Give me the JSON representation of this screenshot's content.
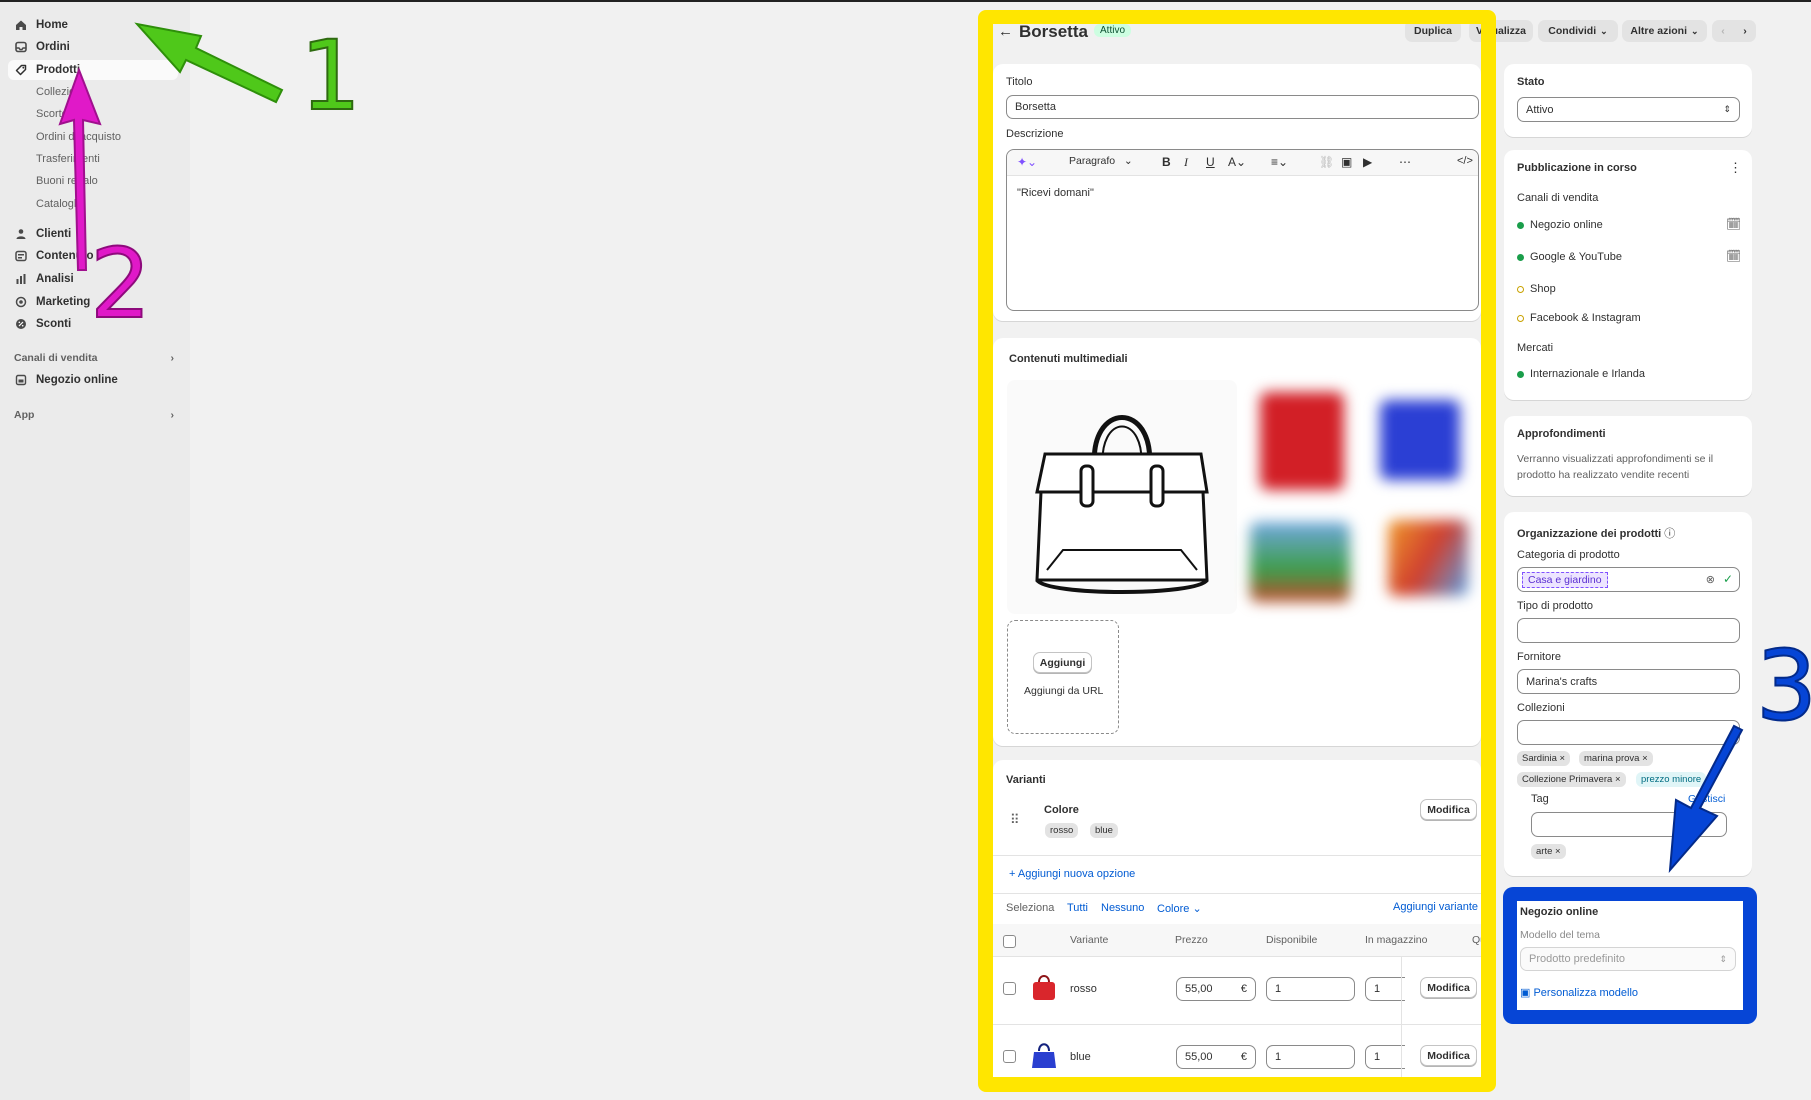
{
  "sidebar": {
    "items": [
      {
        "label": "Home"
      },
      {
        "label": "Ordini"
      },
      {
        "label": "Prodotti"
      },
      {
        "label": "Clienti"
      },
      {
        "label": "Contenuto"
      },
      {
        "label": "Analisi"
      },
      {
        "label": "Marketing"
      },
      {
        "label": "Sconti"
      }
    ],
    "sub_items": [
      "Collezioni",
      "Scorte",
      "Ordini di acquisto",
      "Trasferimenti",
      "Buoni regalo",
      "Cataloghi"
    ],
    "sales_channels_label": "Canali di vendita",
    "online_store_label": "Negozio online",
    "app_label": "App"
  },
  "header": {
    "title": "Borsetta",
    "status_badge": "Attivo",
    "duplicate": "Duplica",
    "view": "Visualizza",
    "share": "Condividi",
    "more_actions": "Altre azioni"
  },
  "product": {
    "title_label": "Titolo",
    "title_value": "Borsetta",
    "description_label": "Descrizione",
    "paragraph_select": "Paragrafo",
    "description_text": "\"Ricevi domani\""
  },
  "media": {
    "heading": "Contenuti multimediali",
    "add_button": "Aggiungi",
    "add_from_url": "Aggiungi da URL"
  },
  "variants": {
    "heading": "Varianti",
    "option_name": "Colore",
    "option_values": [
      "rosso",
      "blue"
    ],
    "edit_button": "Modifica",
    "add_option": "Aggiungi nuova opzione",
    "select_label": "Seleziona",
    "select_all": "Tutti",
    "select_none": "Nessuno",
    "select_color": "Colore",
    "add_variant": "Aggiungi variante",
    "columns": [
      "Variante",
      "Prezzo",
      "Disponibile",
      "In magazzino",
      "Qu"
    ],
    "rows": [
      {
        "name": "rosso",
        "price": "55,00",
        "currency": "€",
        "available": "1",
        "stock": "1",
        "action": "Modifica",
        "color": "#d9262c"
      },
      {
        "name": "blue",
        "price": "55,00",
        "currency": "€",
        "available": "1",
        "stock": "1",
        "action": "Modifica",
        "color": "#2a3fd0"
      }
    ]
  },
  "status_card": {
    "heading": "Stato",
    "value": "Attivo"
  },
  "publishing": {
    "heading": "Pubblicazione in corso",
    "channels_label": "Canali di vendita",
    "channels": [
      {
        "name": "Negozio online",
        "state": "active"
      },
      {
        "name": "Google & YouTube",
        "state": "active"
      },
      {
        "name": "Shop",
        "state": "inactive"
      },
      {
        "name": "Facebook & Instagram",
        "state": "inactive"
      }
    ],
    "markets_label": "Mercati",
    "markets": [
      {
        "name": "Internazionale e Irlanda",
        "state": "active"
      }
    ]
  },
  "insights": {
    "heading": "Approfondimenti",
    "text_line1": "Verranno visualizzati approfondimenti se il",
    "text_line2": "prodotto ha realizzato vendite recenti"
  },
  "organization": {
    "heading": "Organizzazione dei prodotti",
    "category_label": "Categoria di prodotto",
    "category_value": "Casa e giardino",
    "type_label": "Tipo di prodotto",
    "type_value": "",
    "vendor_label": "Fornitore",
    "vendor_value": "Marina's crafts",
    "collections_label": "Collezioni",
    "collections": [
      "Sardinia",
      "marina prova",
      "Collezione Primavera",
      "prezzo minore"
    ],
    "tags_label": "Tag",
    "tags_manage": "Gestisci",
    "tags": [
      "arte"
    ]
  },
  "theme": {
    "heading": "Negozio online",
    "template_label": "Modello del tema",
    "template_value": "Prodotto predefinito",
    "customize": "Personalizza modello"
  },
  "annotations": {
    "one": "1",
    "two": "2",
    "three": "3"
  },
  "colors": {
    "yellow_highlight": "#ffe600",
    "blue_highlight": "#0645d6",
    "green_arrow": "#4fc81a",
    "magenta_arrow": "#e019c8",
    "active_green": "#1a9e4b",
    "link_blue": "#005bd3"
  }
}
